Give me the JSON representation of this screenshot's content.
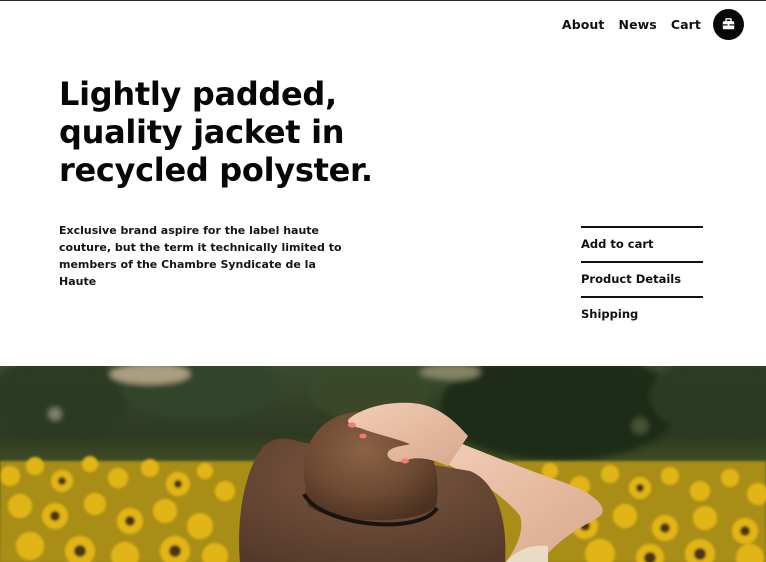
{
  "nav": {
    "items": [
      {
        "label": "About"
      },
      {
        "label": "News"
      },
      {
        "label": "Cart"
      }
    ],
    "bag_icon": "shopping-bag-icon"
  },
  "hero_copy": {
    "headline": "Lightly padded, quality jacket in recycled polyster.",
    "description": "Exclusive brand aspire for the label haute couture, but the term it technically limited to members of the Chambre Syndicate de la Haute"
  },
  "actions": {
    "items": [
      {
        "label": "Add to cart"
      },
      {
        "label": "Product Details"
      },
      {
        "label": "Shipping"
      }
    ]
  },
  "hero_image": {
    "subject": "photo-woman-with-hat-in-sunflower-field"
  },
  "colors": {
    "text": "#070707",
    "background": "#ffffff",
    "button": "#070707"
  }
}
